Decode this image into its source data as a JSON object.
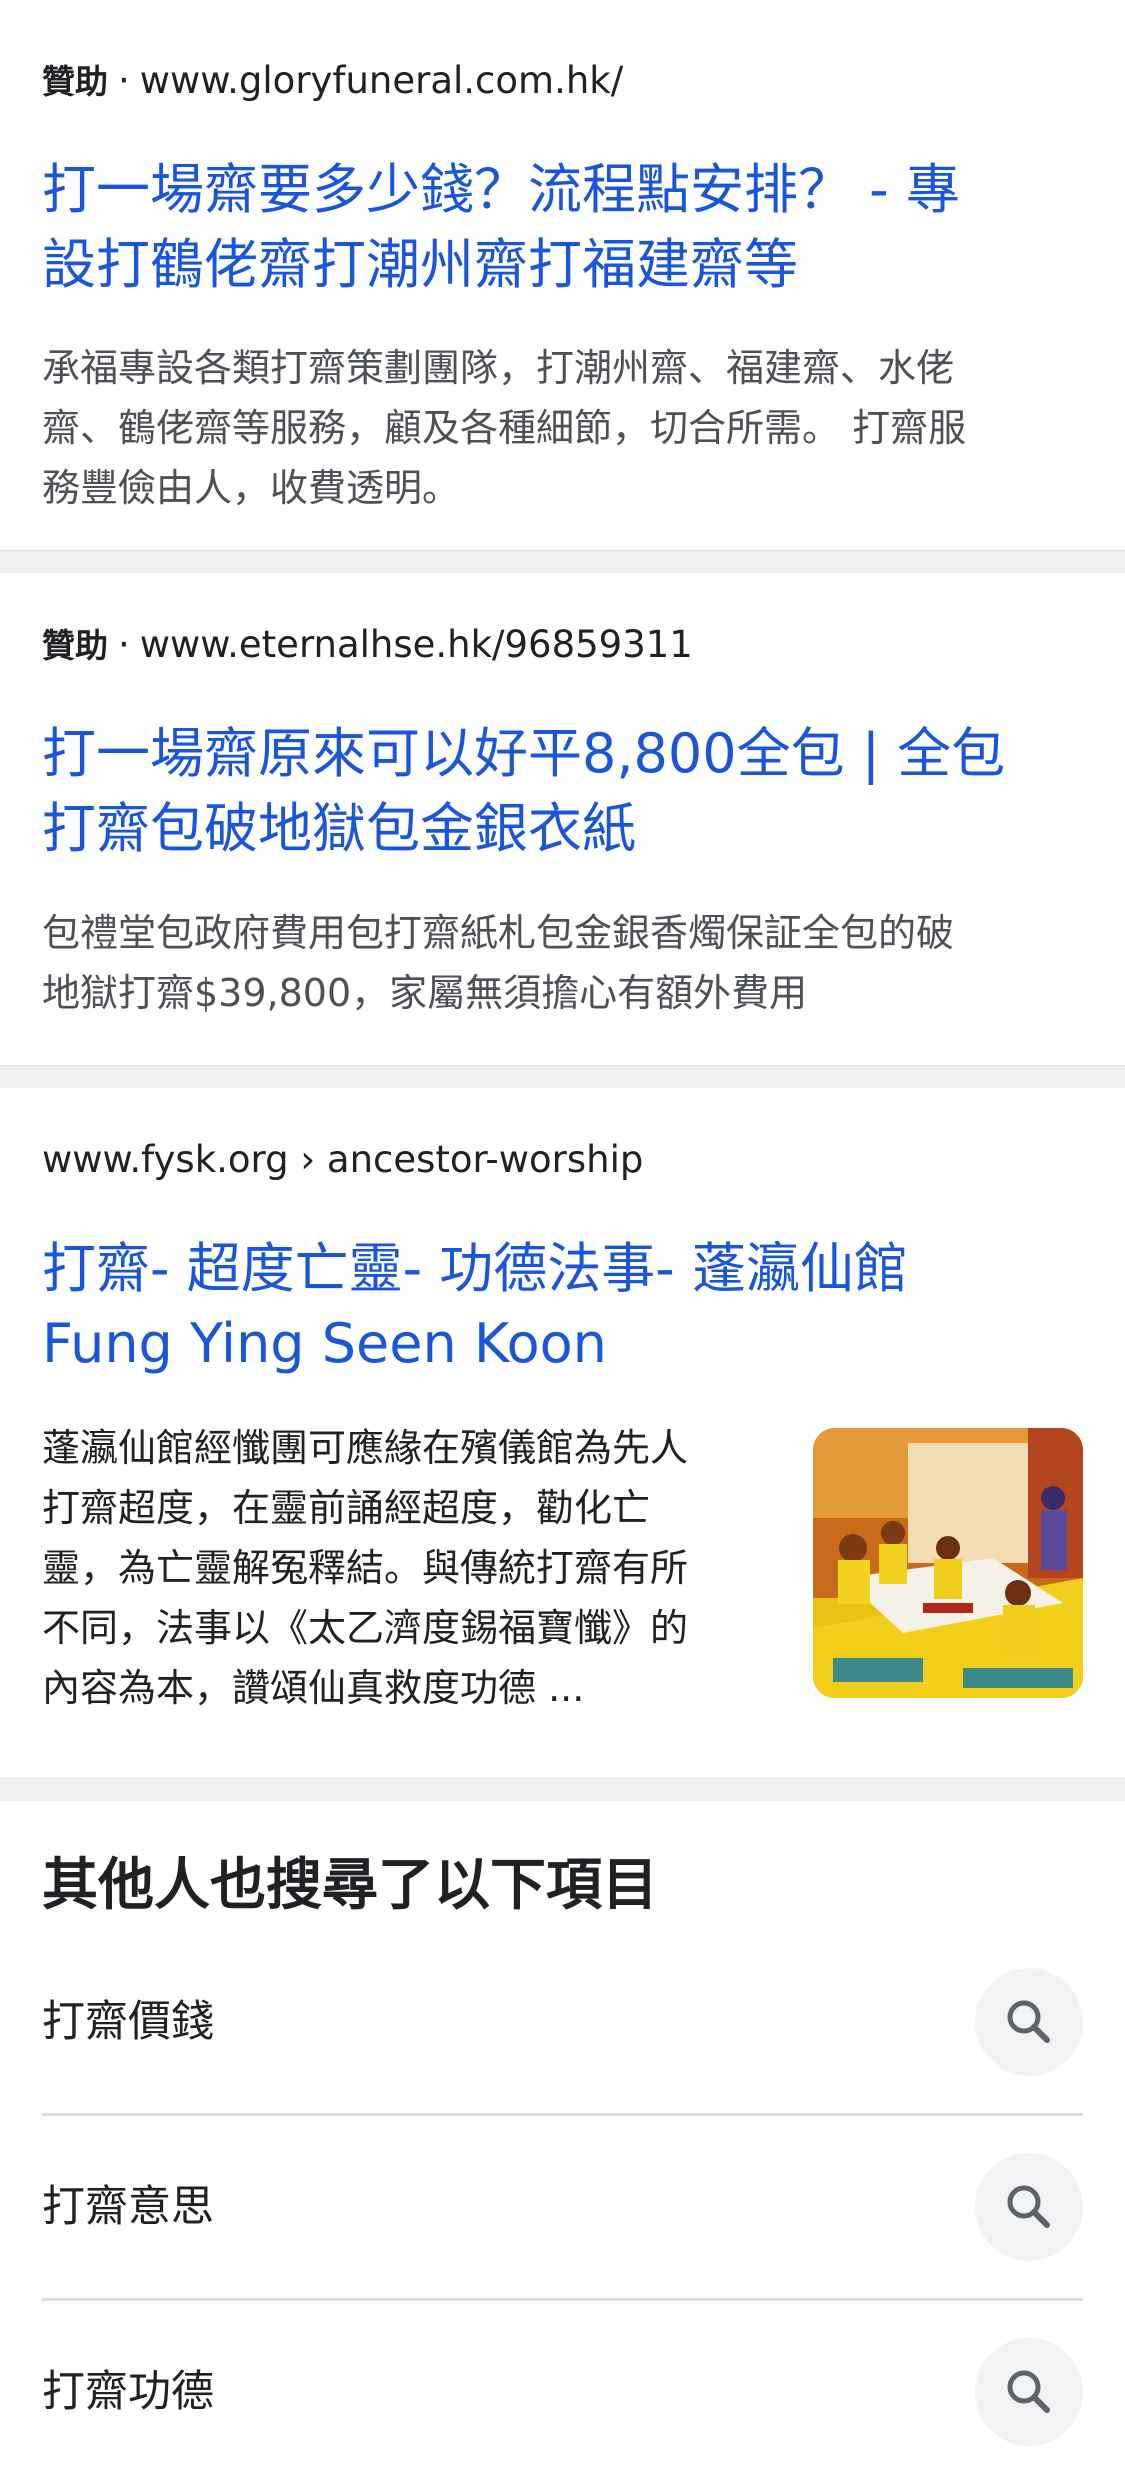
{
  "results": [
    {
      "ad_label": "贊助",
      "separator": "·",
      "url": "www.gloryfuneral.com.hk/",
      "title_lines": [
        "打一場齋要多少錢？流程點安排？ - 專",
        "設打鶴佬齋打潮州齋打福建齋等"
      ],
      "snippet_lines": [
        "承福專設各類打齋策劃團隊，打潮州齋、福建齋、水佬",
        "齋、鶴佬齋等服務，顧及各種細節，切合所需。 打齋服",
        "務豐儉由人，收費透明。"
      ]
    },
    {
      "ad_label": "贊助",
      "separator": "·",
      "url": "www.eternalhse.hk/96859311",
      "title_lines": [
        "打一場齋原來可以好平8,800全包 | 全包",
        "打齋包破地獄包金銀衣紙"
      ],
      "snippet_lines": [
        "包禮堂包政府費用包打齋紙札包金銀香燭保証全包的破",
        "地獄打齋$39,800，家屬無須擔心有額外費用"
      ]
    },
    {
      "domain": "www.fysk.org",
      "breadcrumb_sep": "›",
      "path": "ancestor-worship",
      "title_lines": [
        "打齋- 超度亡靈- 功德法事- 蓬瀛仙館",
        "Fung Ying Seen Koon"
      ],
      "snippet_lines": [
        "蓬瀛仙館經懺團可應緣在殯儀館為先人",
        "打齋超度，在靈前誦經超度，勸化亡",
        "靈，為亡靈解冤釋結。與傳統打齋有所",
        "不同，法事以《太乙濟度錫福寶懺》的",
        "內容為本，讚頌仙真救度功德 ..."
      ]
    }
  ],
  "related": {
    "title": "其他人也搜尋了以下項目",
    "items": [
      "打齋價錢",
      "打齋意思",
      "打齋功德"
    ]
  },
  "icons": {
    "search": "search-icon",
    "thumbnail": "ceremony-photo"
  },
  "colors": {
    "link": "#1a56db",
    "text": "#202124",
    "snippet": "#4d5156",
    "separator_bg": "#eef0f2",
    "search_btn_bg": "#f1f3f4"
  }
}
